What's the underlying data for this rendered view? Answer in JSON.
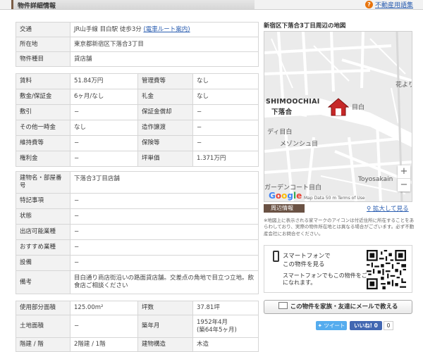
{
  "header": {
    "title": "物件詳細情報",
    "help_icon": "?",
    "help_link": "不動産用語集"
  },
  "table1": [
    {
      "label": "交通",
      "value": "JR山手線 目白駅 徒歩3分",
      "link": "(電車ルート案内)"
    },
    {
      "label": "所在地",
      "value": "東京都新宿区下落合3丁目"
    },
    {
      "label": "物件種目",
      "value": "貸店舗"
    }
  ],
  "table2": [
    [
      {
        "label": "賃料",
        "value": "51.84万円"
      },
      {
        "label": "管理費等",
        "value": "なし"
      }
    ],
    [
      {
        "label": "敷金/保証金",
        "value": "6ヶ月/なし"
      },
      {
        "label": "礼金",
        "value": "なし"
      }
    ],
    [
      {
        "label": "敷引",
        "value": "−"
      },
      {
        "label": "保証金償却",
        "value": "−"
      }
    ],
    [
      {
        "label": "その他一時金",
        "value": "なし"
      },
      {
        "label": "造作譲渡",
        "value": "−"
      }
    ],
    [
      {
        "label": "維持費等",
        "value": "−"
      },
      {
        "label": "保険等",
        "value": "−"
      }
    ],
    [
      {
        "label": "権利金",
        "value": "−"
      },
      {
        "label": "坪単価",
        "value": "1.371万円"
      }
    ]
  ],
  "table3": [
    {
      "label": "建物名・部屋番号",
      "value": "下落合3丁目店舗"
    },
    {
      "label": "特記事項",
      "value": "−"
    },
    {
      "label": "状態",
      "value": "−"
    },
    {
      "label": "出店可能業種",
      "value": "−"
    },
    {
      "label": "おすすめ業種",
      "value": "−"
    },
    {
      "label": "設備",
      "value": "−"
    },
    {
      "label": "備考",
      "value": "目白通り商店街沿いの路面貸店舗。交差点の角地で目立つ立地。飲食店ご相談ください"
    }
  ],
  "table4": [
    [
      {
        "label": "使用部分面積",
        "value": "125.00m²"
      },
      {
        "label": "坪数",
        "value": "37.81坪"
      }
    ],
    [
      {
        "label": "土地面積",
        "value": "−"
      },
      {
        "label": "築年月",
        "value": "1952年4月",
        "value2": "(築64年5ヶ月)"
      }
    ],
    [
      {
        "label": "階建 / 階",
        "value": "2階建 / 1階"
      },
      {
        "label": "建物構造",
        "value": "木造"
      }
    ]
  ],
  "map": {
    "title": "新宿区下落合3丁目周辺の地図",
    "label_en": "SHIMOOCHIAI",
    "label_jp": "下落合",
    "labels": [
      "花より",
      "ディ目白",
      "メゾンシュ目",
      "ガーデンコート目白",
      "Toyosakain",
      "目白"
    ],
    "attribution": "Map Data   50 m     Terms of Use",
    "zoom_in": "+",
    "zoom_out": "−",
    "google": [
      "G",
      "o",
      "o",
      "g",
      "l",
      "e"
    ]
  },
  "around_button": "周辺情報",
  "enlarge_link": "拡大して見る",
  "note": "※地図上に表示される家マークのアイコンは付近住所に所在することをあらわしており、実際の物件所在地とは異なる場合がございます。必ず不動産会社にお問合せください。",
  "smartphone": {
    "title": "スマートフォンで",
    "subtitle": "この物件を見る",
    "desc1": "スマートフォンでもこの物件をご覧",
    "desc2": "になれます。"
  },
  "mail_button": "この物件を家族・友達にメールで教える",
  "social": {
    "tweet": "ツイート",
    "like": "いいね! 0",
    "count": "0"
  },
  "colors": {
    "accent": "#6a5244",
    "link": "#2a5db0",
    "header_bg": "#f2f2f2",
    "pin": "#c62828"
  }
}
